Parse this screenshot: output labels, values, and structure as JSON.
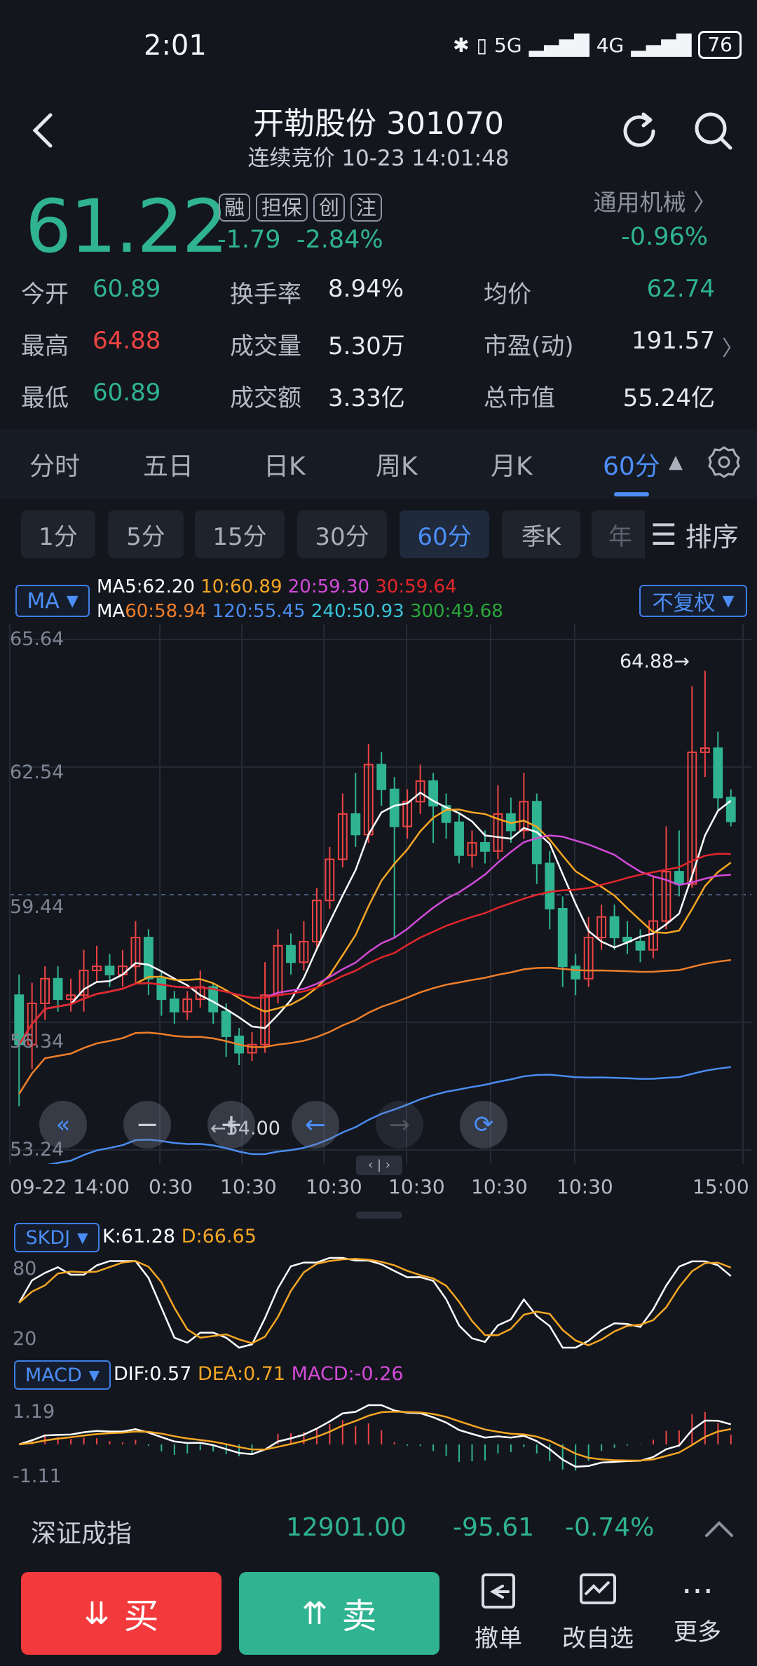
{
  "status": {
    "time": "2:01",
    "network1": "5G",
    "network2": "4G",
    "battery": "76"
  },
  "header": {
    "title": "开勒股份 301070",
    "subtitle": "连续竞价 10-23 14:01:48"
  },
  "quote": {
    "price": "61.22",
    "tags": [
      "融",
      "担保",
      "创",
      "注"
    ],
    "change": "-1.79",
    "change_pct": "-2.84%",
    "sector": "通用机械",
    "sector_chg": "-0.96%"
  },
  "stats": [
    {
      "label": "今开",
      "value": "60.89",
      "color": "green"
    },
    {
      "label": "换手率",
      "value": "8.94%",
      "color": "white"
    },
    {
      "label": "均价",
      "value": "62.74",
      "color": "green"
    },
    {
      "label": "最高",
      "value": "64.88",
      "color": "red"
    },
    {
      "label": "成交量",
      "value": "5.30万",
      "color": "white"
    },
    {
      "label": "市盈(动)",
      "value": "191.57",
      "color": "white"
    },
    {
      "label": "最低",
      "value": "60.89",
      "color": "green"
    },
    {
      "label": "成交额",
      "value": "3.33亿",
      "color": "white"
    },
    {
      "label": "总市值",
      "value": "55.24亿",
      "color": "white"
    }
  ],
  "period_tabs": [
    "分时",
    "五日",
    "日K",
    "周K",
    "月K",
    "60分"
  ],
  "sub_tabs": [
    "1分",
    "5分",
    "15分",
    "30分",
    "60分",
    "季K",
    "年"
  ],
  "sort_label": "排序",
  "ma": {
    "selector": "MA",
    "adjust": "不复权",
    "line1": [
      {
        "text": "MA5:62.20",
        "color": "#ffffff"
      },
      {
        "text": "10:60.89",
        "color": "#f5a623"
      },
      {
        "text": "20:59.30",
        "color": "#d24bd8"
      },
      {
        "text": "30:59.64",
        "color": "#e3262b"
      }
    ],
    "line2": [
      {
        "text": "MA",
        "color": "#ffffff"
      },
      {
        "text": "60:58.94",
        "color": "#f07f2a"
      },
      {
        "text": "120:55.45",
        "color": "#4a8df0"
      },
      {
        "text": "240:50.93",
        "color": "#38c3d9"
      },
      {
        "text": "300:49.68",
        "color": "#2aa83a"
      }
    ]
  },
  "kline": {
    "y_labels": [
      "65.64",
      "62.54",
      "59.44",
      "56.34",
      "53.24"
    ],
    "high_marker": "64.88→",
    "cursor_value": "54.00",
    "x_labels": [
      "09-22 14:00",
      "0:30",
      "10:30",
      "10:30",
      "10:30",
      "10:30",
      "10:30",
      "15:00"
    ]
  },
  "chart_data": {
    "type": "candlestick",
    "ylim": [
      53.24,
      65.64
    ],
    "y_ticks": [
      65.64,
      62.54,
      59.44,
      56.34,
      53.24
    ],
    "high": 64.88,
    "candles": [
      [
        57.0,
        55.8,
        57.5,
        54.3
      ],
      [
        55.8,
        56.8,
        57.3,
        55.2
      ],
      [
        56.8,
        57.4,
        57.7,
        56.4
      ],
      [
        57.4,
        56.9,
        57.7,
        56.6
      ],
      [
        56.9,
        57.0,
        57.4,
        56.6
      ],
      [
        57.0,
        57.6,
        58.1,
        56.6
      ],
      [
        57.6,
        57.7,
        58.2,
        57.3
      ],
      [
        57.7,
        57.5,
        58.0,
        57.2
      ],
      [
        57.5,
        57.7,
        58.1,
        57.2
      ],
      [
        57.7,
        58.4,
        58.8,
        57.3
      ],
      [
        58.4,
        57.4,
        58.6,
        57.0
      ],
      [
        57.4,
        56.9,
        57.6,
        56.5
      ],
      [
        56.9,
        56.6,
        57.1,
        56.3
      ],
      [
        56.6,
        56.9,
        57.1,
        56.4
      ],
      [
        56.9,
        57.2,
        57.6,
        56.7
      ],
      [
        57.2,
        56.6,
        57.3,
        56.3
      ],
      [
        56.6,
        56.0,
        56.8,
        55.5
      ],
      [
        56.0,
        55.6,
        56.2,
        55.3
      ],
      [
        55.6,
        55.8,
        56.1,
        55.4
      ],
      [
        55.8,
        57.0,
        57.8,
        55.6
      ],
      [
        57.0,
        58.2,
        58.6,
        56.8
      ],
      [
        58.2,
        57.8,
        58.5,
        57.5
      ],
      [
        57.8,
        58.3,
        58.8,
        57.6
      ],
      [
        58.3,
        59.3,
        59.6,
        58.1
      ],
      [
        59.3,
        60.3,
        60.6,
        59.1
      ],
      [
        60.3,
        61.4,
        61.9,
        60.1
      ],
      [
        61.4,
        60.9,
        62.4,
        60.6
      ],
      [
        60.9,
        62.6,
        63.1,
        60.7
      ],
      [
        62.6,
        62.0,
        62.9,
        61.6
      ],
      [
        62.0,
        61.1,
        62.3,
        58.4
      ],
      [
        61.1,
        61.7,
        62.0,
        60.8
      ],
      [
        61.7,
        62.2,
        62.6,
        61.4
      ],
      [
        62.2,
        61.6,
        62.4,
        60.7
      ],
      [
        61.6,
        61.2,
        61.9,
        60.8
      ],
      [
        61.2,
        60.4,
        61.4,
        60.2
      ],
      [
        60.4,
        60.7,
        61.0,
        60.1
      ],
      [
        60.7,
        60.5,
        61.0,
        60.2
      ],
      [
        60.5,
        61.4,
        62.1,
        60.3
      ],
      [
        61.4,
        61.0,
        61.8,
        60.7
      ],
      [
        61.0,
        61.7,
        62.4,
        60.8
      ],
      [
        61.7,
        60.2,
        61.9,
        59.7
      ],
      [
        60.2,
        59.1,
        60.5,
        58.6
      ],
      [
        59.1,
        57.7,
        59.4,
        57.2
      ],
      [
        57.7,
        57.4,
        58.0,
        57.0
      ],
      [
        57.4,
        58.4,
        58.9,
        57.2
      ],
      [
        58.4,
        58.9,
        59.2,
        58.1
      ],
      [
        58.9,
        58.4,
        59.2,
        58.1
      ],
      [
        58.4,
        58.3,
        58.8,
        58.0
      ],
      [
        58.3,
        58.1,
        58.6,
        57.8
      ],
      [
        58.1,
        58.8,
        59.9,
        57.9
      ],
      [
        58.8,
        60.0,
        61.1,
        58.6
      ],
      [
        60.0,
        59.7,
        61.0,
        59.4
      ],
      [
        59.7,
        62.9,
        64.5,
        59.6
      ],
      [
        62.9,
        63.0,
        64.88,
        62.3
      ],
      [
        63.0,
        61.8,
        63.4,
        61.5
      ],
      [
        61.8,
        61.22,
        62.0,
        61.1
      ]
    ]
  },
  "skdj": {
    "selector": "SKDJ",
    "k": "K:61.28",
    "d": "D:66.65",
    "y_labels": [
      "80",
      "20"
    ]
  },
  "macd": {
    "selector": "MACD",
    "dif": "DIF:0.57",
    "dea": "DEA:0.71",
    "macd": "MACD:-0.26",
    "y_labels": [
      "1.19",
      "-1.11"
    ]
  },
  "index": {
    "name": "深证成指",
    "value": "12901.00",
    "change": "-95.61",
    "pct": "-0.74%"
  },
  "actions": {
    "buy": "买",
    "sell": "卖",
    "cancel": "撤单",
    "edit_watch": "改自选",
    "more": "更多"
  }
}
